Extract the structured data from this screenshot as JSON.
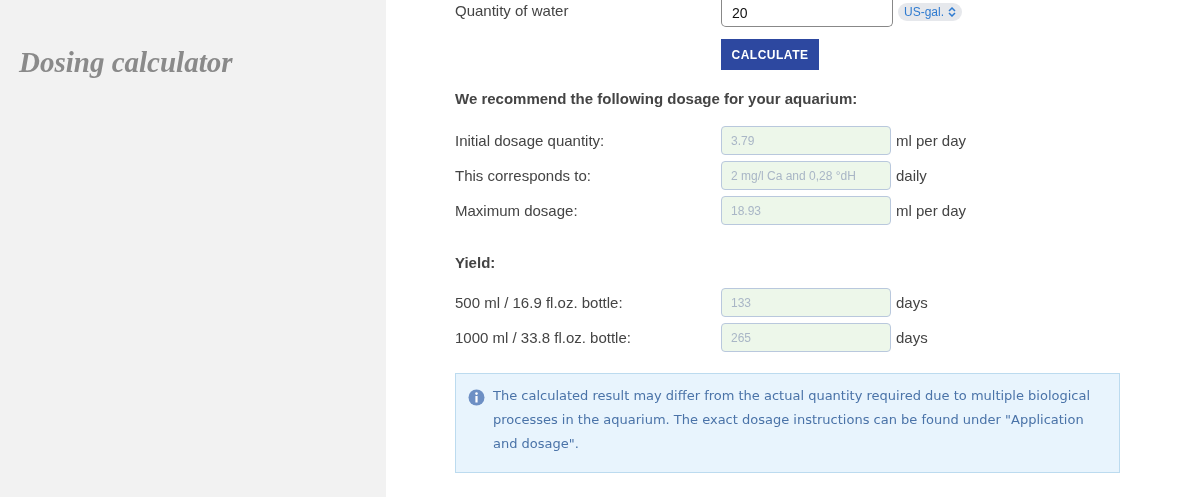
{
  "sidebar": {
    "title": "Dosing calculator"
  },
  "water": {
    "label": "Quantity of water",
    "value": "20",
    "unit": "US-gal.",
    "button": "CALCULATE"
  },
  "recommendation": {
    "heading": "We recommend the following dosage for your aquarium:",
    "rows": [
      {
        "label": "Initial dosage quantity:",
        "value": "3.79",
        "unit": "ml per day"
      },
      {
        "label": "This corresponds to:",
        "value": "2 mg/l Ca and 0,28 °dH",
        "unit": "daily"
      },
      {
        "label": "Maximum dosage:",
        "value": "18.93",
        "unit": "ml per day"
      }
    ]
  },
  "yield": {
    "heading": "Yield:",
    "rows": [
      {
        "label": "500 ml / 16.9 fl.oz. bottle:",
        "value": "133",
        "unit": "days"
      },
      {
        "label": "1000 ml / 33.8 fl.oz. bottle:",
        "value": "265",
        "unit": "days"
      }
    ]
  },
  "info": {
    "text": "The calculated result may differ from the actual quantity required due to multiple biological processes in the aquarium. The exact dosage instructions can be found under \"Application and dosage\"."
  }
}
